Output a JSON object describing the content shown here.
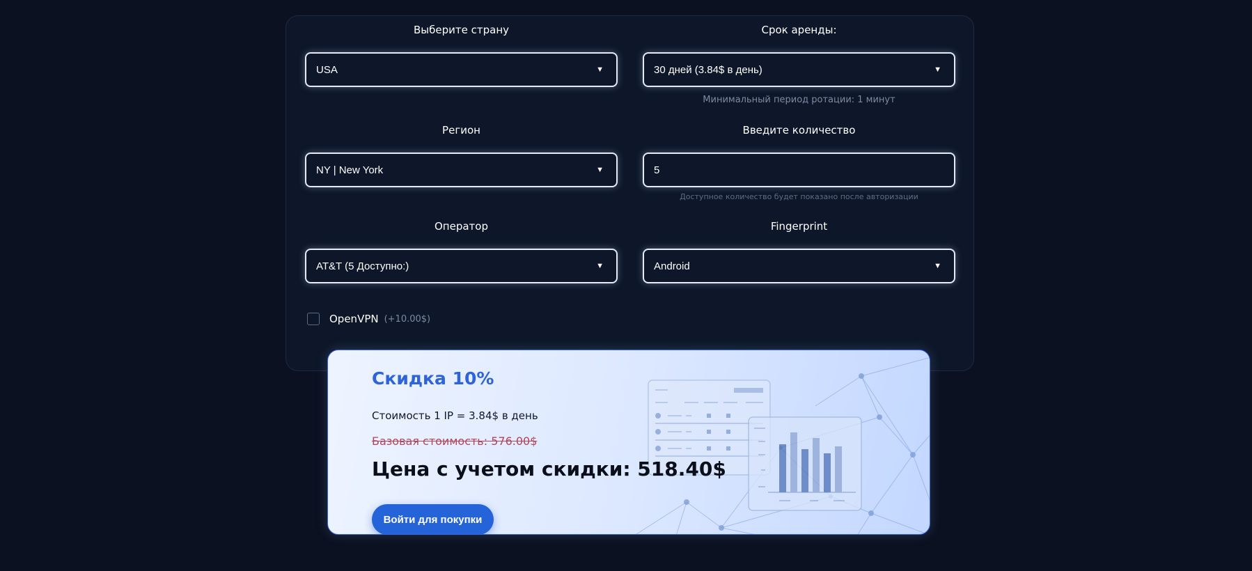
{
  "form": {
    "country": {
      "label": "Выберите страну",
      "value": "USA"
    },
    "term": {
      "label": "Срок аренды:",
      "value": "30 дней (3.84$ в день)",
      "hint": "Минимальный период ротации: 1 минут"
    },
    "region": {
      "label": "Регион",
      "value": "NY | New York"
    },
    "quantity": {
      "label": "Введите количество",
      "value": "5",
      "hint": "Доступное количество будет показано после авторизации"
    },
    "operator": {
      "label": "Оператор",
      "value": "AT&T (5 Доступно:)"
    },
    "fingerprint": {
      "label": "Fingerprint",
      "value": "Android"
    },
    "openvpn": {
      "label": "OpenVPN",
      "price": "(+10.00$)",
      "checked": false
    }
  },
  "promo": {
    "title": "Скидка 10%",
    "ip_cost": "Стоимость 1 IP = 3.84$ в день",
    "base_price": "Базовая стоимость: 576.00$",
    "final_price": "Цена с учетом скидки: 518.40$",
    "login_button": "Войти для покупки"
  },
  "colors": {
    "background": "#0b1120",
    "panel": "#0d1729",
    "accent": "#2563d8",
    "discount_title": "#2e64d8",
    "strikethrough": "#b2455a"
  }
}
